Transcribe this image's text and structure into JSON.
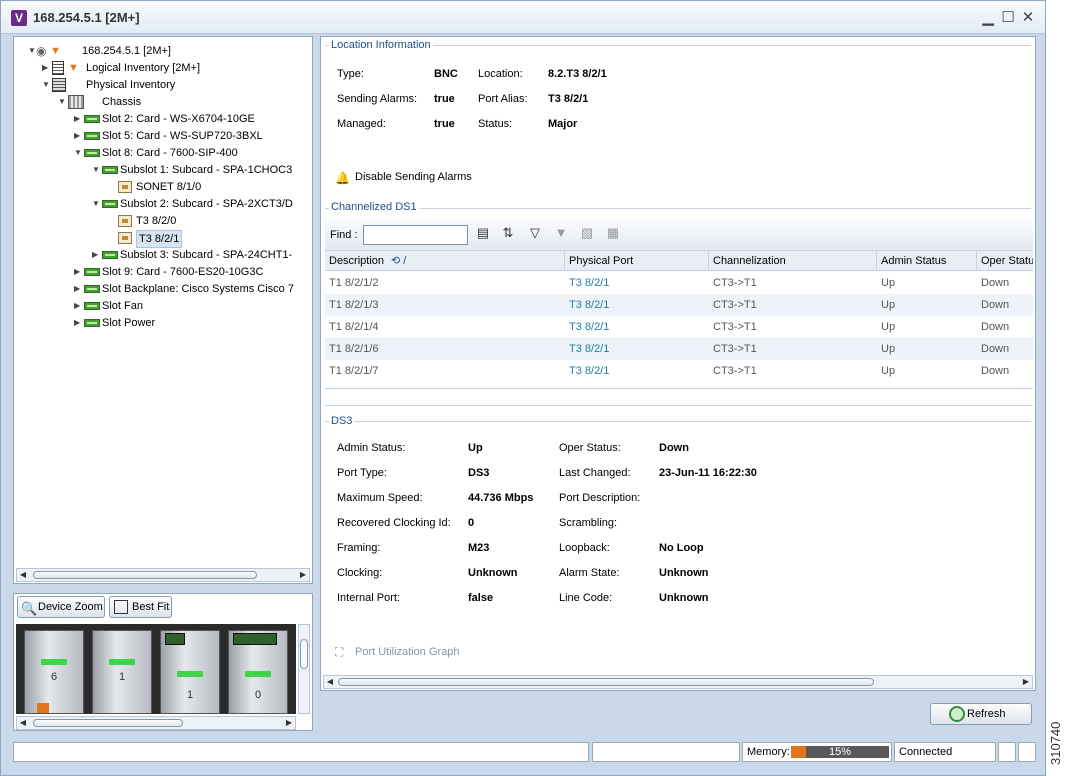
{
  "window": {
    "title": "168.254.5.1 [2M+]",
    "logo_letter": "V"
  },
  "tree": {
    "items": [
      {
        "label": "168.254.5.1 [2M+]"
      },
      {
        "label": "Logical Inventory [2M+]"
      },
      {
        "label": "Physical Inventory"
      },
      {
        "label": "Chassis"
      },
      {
        "label": "Slot 2: Card - WS-X6704-10GE"
      },
      {
        "label": "Slot 5: Card - WS-SUP720-3BXL"
      },
      {
        "label": "Slot 8: Card - 7600-SIP-400"
      },
      {
        "label": "Subslot 1: Subcard - SPA-1CHOC3"
      },
      {
        "label": "SONET 8/1/0"
      },
      {
        "label": "Subslot 2: Subcard - SPA-2XCT3/D"
      },
      {
        "label": "T3 8/2/0"
      },
      {
        "label": "T3 8/2/1"
      },
      {
        "label": "Subslot 3: Subcard - SPA-24CHT1-"
      },
      {
        "label": "Slot 9: Card - 7600-ES20-10G3C"
      },
      {
        "label": "Slot Backplane: Cisco Systems Cisco 7"
      },
      {
        "label": "Slot Fan"
      },
      {
        "label": "Slot Power"
      }
    ]
  },
  "device_view": {
    "zoom_label": "Device Zoom",
    "fit_label": "Best Fit",
    "slots": [
      "6",
      "1",
      "1",
      "0"
    ]
  },
  "location": {
    "title": "Location Information",
    "type_label": "Type:",
    "type_value": "BNC",
    "location_label": "Location:",
    "location_value": "8.2.T3 8/2/1",
    "sending_label": "Sending Alarms:",
    "sending_value": "true",
    "alias_label": "Port Alias:",
    "alias_value": "T3 8/2/1",
    "managed_label": "Managed:",
    "managed_value": "true",
    "status_label": "Status:",
    "status_value": "Major",
    "disable_alarms": "Disable Sending Alarms"
  },
  "ds1": {
    "title": "Channelized DS1",
    "find_label": "Find :",
    "find_value": "",
    "columns": [
      "Description",
      "Physical Port",
      "Channelization",
      "Admin Status",
      "Oper Status"
    ],
    "rows": [
      [
        "T1 8/2/1/2",
        "T3 8/2/1",
        "CT3->T1",
        "Up",
        "Down"
      ],
      [
        "T1 8/2/1/3",
        "T3 8/2/1",
        "CT3->T1",
        "Up",
        "Down"
      ],
      [
        "T1 8/2/1/4",
        "T3 8/2/1",
        "CT3->T1",
        "Up",
        "Down"
      ],
      [
        "T1 8/2/1/6",
        "T3 8/2/1",
        "CT3->T1",
        "Up",
        "Down"
      ],
      [
        "T1 8/2/1/7",
        "T3 8/2/1",
        "CT3->T1",
        "Up",
        "Down"
      ]
    ]
  },
  "ds3": {
    "title": "DS3",
    "left": [
      {
        "label": "Admin Status:",
        "value": "Up"
      },
      {
        "label": "Port Type:",
        "value": "DS3"
      },
      {
        "label": "Maximum Speed:",
        "value": "44.736 Mbps"
      },
      {
        "label": "Recovered Clocking Id:",
        "value": "0"
      },
      {
        "label": "Framing:",
        "value": "M23"
      },
      {
        "label": "Clocking:",
        "value": "Unknown"
      },
      {
        "label": "Internal Port:",
        "value": "false"
      }
    ],
    "right": [
      {
        "label": "Oper Status:",
        "value": "Down"
      },
      {
        "label": "Last Changed:",
        "value": "23-Jun-11 16:22:30"
      },
      {
        "label": "Port Description:",
        "value": ""
      },
      {
        "label": "Scrambling:",
        "value": ""
      },
      {
        "label": "Loopback:",
        "value": "No Loop"
      },
      {
        "label": "Alarm State:",
        "value": "Unknown"
      },
      {
        "label": "Line Code:",
        "value": "Unknown"
      }
    ],
    "graph_link": "Port Utilization Graph"
  },
  "refresh_label": "Refresh",
  "statusbar": {
    "memory_label": "Memory:",
    "memory_value": "15%",
    "memory_fraction": 0.15,
    "connection": "Connected"
  },
  "figure_id": "310740",
  "colors": {
    "link": "#1f7fa6",
    "accent": "#e2761c",
    "group_title": "#1f4f8b"
  }
}
